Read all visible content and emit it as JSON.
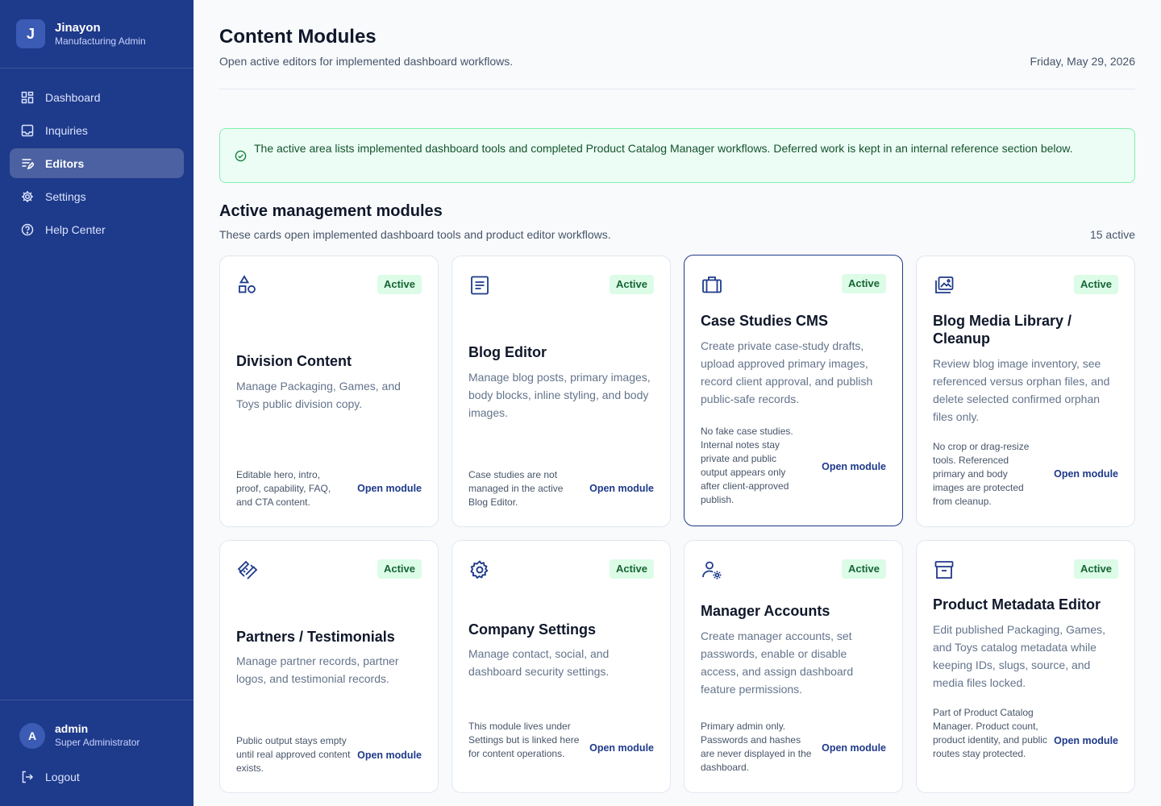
{
  "sidebar": {
    "brand_initial": "J",
    "brand_name": "Jinayon",
    "brand_role": "Manufacturing Admin",
    "items": [
      {
        "label": "Dashboard",
        "icon": "dashboard-icon"
      },
      {
        "label": "Inquiries",
        "icon": "inbox-icon"
      },
      {
        "label": "Editors",
        "icon": "editors-icon",
        "active": true
      },
      {
        "label": "Settings",
        "icon": "gear-icon"
      },
      {
        "label": "Help Center",
        "icon": "help-icon"
      }
    ],
    "user_initial": "A",
    "user_name": "admin",
    "user_role": "Super Administrator",
    "logout_label": "Logout"
  },
  "header": {
    "title": "Content Modules",
    "subtitle": "Open active editors for implemented dashboard workflows.",
    "date": "Friday, May 29, 2026"
  },
  "notice": {
    "text": "The active area lists implemented dashboard tools and completed Product Catalog Manager workflows. Deferred work is kept in an internal reference section below."
  },
  "section": {
    "title": "Active management modules",
    "subtitle": "These cards open implemented dashboard tools and product editor workflows.",
    "count": "15 active"
  },
  "cards": [
    {
      "icon": "shapes-icon",
      "badge": "Active",
      "title": "Division Content",
      "description": "Manage Packaging, Games, and Toys public division copy.",
      "note": "Editable hero, intro, proof, capability, FAQ, and CTA content.",
      "link": "Open module"
    },
    {
      "icon": "document-icon",
      "badge": "Active",
      "title": "Blog Editor",
      "description": "Manage blog posts, primary images, body blocks, inline styling, and body images.",
      "note": "Case studies are not managed in the active Blog Editor.",
      "link": "Open module"
    },
    {
      "icon": "briefcase-icon",
      "badge": "Active",
      "title": "Case Studies CMS",
      "description": "Create private case-study drafts, upload approved primary images, record client approval, and publish public-safe records.",
      "note": "No fake case studies. Internal notes stay private and public output appears only after client-approved publish.",
      "link": "Open module"
    },
    {
      "icon": "photo-library-icon",
      "badge": "Active",
      "title": "Blog Media Library / Cleanup",
      "description": "Review blog image inventory, see referenced versus orphan files, and delete selected confirmed orphan files only.",
      "note": "No crop or drag-resize tools. Referenced primary and body images are protected from cleanup.",
      "link": "Open module"
    },
    {
      "icon": "handshake-icon",
      "badge": "Active",
      "title": "Partners / Testimonials",
      "description": "Manage partner records, partner logos, and testimonial records.",
      "note": "Public output stays empty until real approved content exists.",
      "link": "Open module"
    },
    {
      "icon": "gear-icon",
      "badge": "Active",
      "title": "Company Settings",
      "description": "Manage contact, social, and dashboard security settings.",
      "note": "This module lives under Settings but is linked here for content operations.",
      "link": "Open module"
    },
    {
      "icon": "user-settings-icon",
      "badge": "Active",
      "title": "Manager Accounts",
      "description": "Create manager accounts, set passwords, enable or disable access, and assign dashboard feature permissions.",
      "note": "Primary admin only. Passwords and hashes are never displayed in the dashboard.",
      "link": "Open module"
    },
    {
      "icon": "archive-icon",
      "badge": "Active",
      "title": "Product Metadata Editor",
      "description": "Edit published Packaging, Games, and Toys catalog metadata while keeping IDs, slugs, source, and media files locked.",
      "note": "Part of Product Catalog Manager. Product count, product identity, and public routes stay protected.",
      "link": "Open module"
    }
  ]
}
